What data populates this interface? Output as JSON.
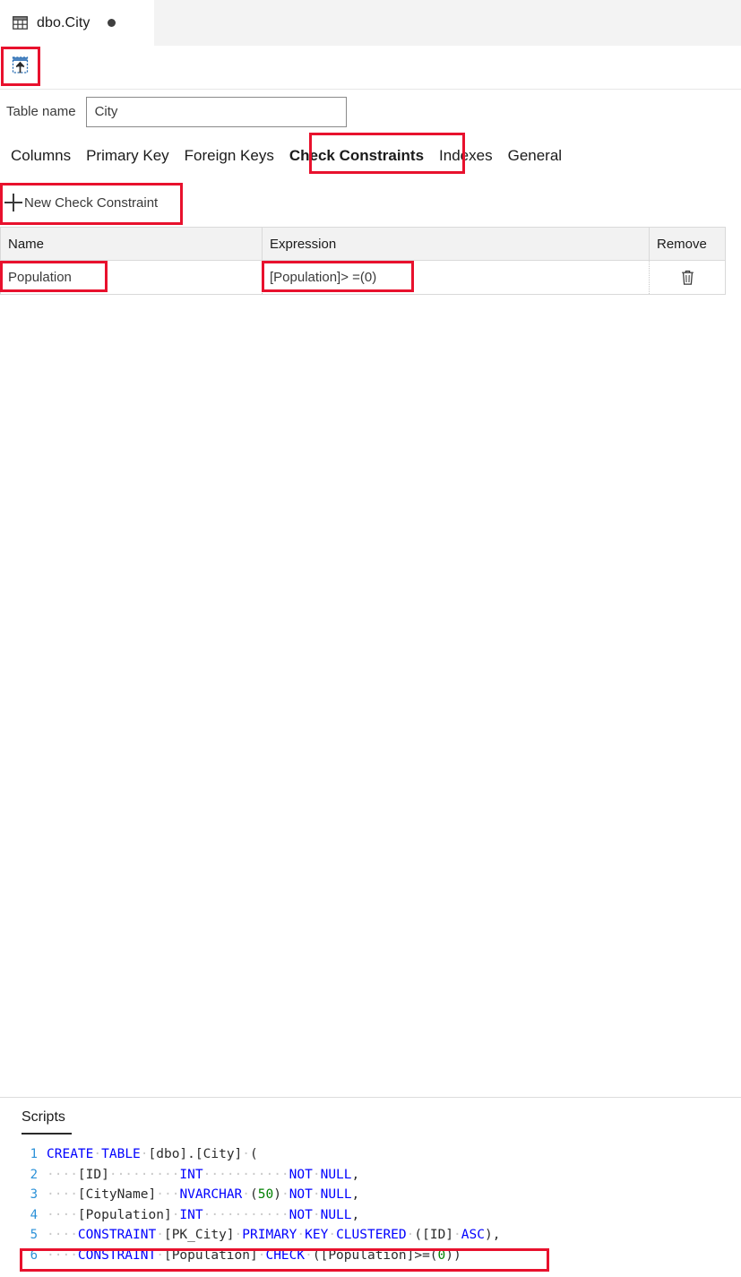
{
  "tabstrip": {
    "active_tab": {
      "title": "dbo.City",
      "icon": "table-grid-icon",
      "dirty": true
    }
  },
  "toolbar": {
    "update_button": {
      "name": "update-icon",
      "tooltip": "Update"
    }
  },
  "table_name_row": {
    "label": "Table name",
    "value": "City",
    "placeholder": ""
  },
  "designer_tabs": [
    {
      "label": "Columns",
      "active": false
    },
    {
      "label": "Primary Key",
      "active": false
    },
    {
      "label": "Foreign Keys",
      "active": false
    },
    {
      "label": "Check Constraints",
      "active": true
    },
    {
      "label": "Indexes",
      "active": false
    },
    {
      "label": "General",
      "active": false
    }
  ],
  "new_constraint_button": {
    "label": "New Check Constraint",
    "icon": "plus-icon"
  },
  "grid": {
    "columns": [
      "Name",
      "Expression",
      "Remove"
    ],
    "rows": [
      {
        "name": "Population",
        "expression": "[Population]> =(0)",
        "remove_icon": "trash-icon"
      }
    ]
  },
  "scripts": {
    "tab_label": "Scripts",
    "lines": [
      {
        "number": "1",
        "tokens": [
          {
            "t": "CREATE",
            "c": "kw"
          },
          {
            "t": "·",
            "c": "ws"
          },
          {
            "t": "TABLE",
            "c": "kw"
          },
          {
            "t": "·",
            "c": "ws"
          },
          {
            "t": "[dbo].[City]",
            "c": "id"
          },
          {
            "t": "·",
            "c": "ws"
          },
          {
            "t": "(",
            "c": "pun"
          }
        ]
      },
      {
        "number": "2",
        "tokens": [
          {
            "t": "····",
            "c": "ws"
          },
          {
            "t": "[ID]",
            "c": "id"
          },
          {
            "t": "·········",
            "c": "ws"
          },
          {
            "t": "INT",
            "c": "kw"
          },
          {
            "t": "···········",
            "c": "ws"
          },
          {
            "t": "NOT",
            "c": "kw"
          },
          {
            "t": "·",
            "c": "ws"
          },
          {
            "t": "NULL",
            "c": "kw"
          },
          {
            "t": ",",
            "c": "pun"
          }
        ]
      },
      {
        "number": "3",
        "tokens": [
          {
            "t": "····",
            "c": "ws"
          },
          {
            "t": "[CityName]",
            "c": "id"
          },
          {
            "t": "···",
            "c": "ws"
          },
          {
            "t": "NVARCHAR",
            "c": "kw"
          },
          {
            "t": "·",
            "c": "ws"
          },
          {
            "t": "(",
            "c": "pun"
          },
          {
            "t": "50",
            "c": "num"
          },
          {
            "t": ")",
            "c": "pun"
          },
          {
            "t": "·",
            "c": "ws"
          },
          {
            "t": "NOT",
            "c": "kw"
          },
          {
            "t": "·",
            "c": "ws"
          },
          {
            "t": "NULL",
            "c": "kw"
          },
          {
            "t": ",",
            "c": "pun"
          }
        ]
      },
      {
        "number": "4",
        "tokens": [
          {
            "t": "····",
            "c": "ws"
          },
          {
            "t": "[Population]",
            "c": "id"
          },
          {
            "t": "·",
            "c": "ws"
          },
          {
            "t": "INT",
            "c": "kw"
          },
          {
            "t": "···········",
            "c": "ws"
          },
          {
            "t": "NOT",
            "c": "kw"
          },
          {
            "t": "·",
            "c": "ws"
          },
          {
            "t": "NULL",
            "c": "kw"
          },
          {
            "t": ",",
            "c": "pun"
          }
        ]
      },
      {
        "number": "5",
        "tokens": [
          {
            "t": "····",
            "c": "ws"
          },
          {
            "t": "CONSTRAINT",
            "c": "kw"
          },
          {
            "t": "·",
            "c": "ws"
          },
          {
            "t": "[PK_City]",
            "c": "id"
          },
          {
            "t": "·",
            "c": "ws"
          },
          {
            "t": "PRIMARY",
            "c": "kw"
          },
          {
            "t": "·",
            "c": "ws"
          },
          {
            "t": "KEY",
            "c": "kw"
          },
          {
            "t": "·",
            "c": "ws"
          },
          {
            "t": "CLUSTERED",
            "c": "kw"
          },
          {
            "t": "·",
            "c": "ws"
          },
          {
            "t": "(",
            "c": "pun"
          },
          {
            "t": "[ID]",
            "c": "id"
          },
          {
            "t": "·",
            "c": "ws"
          },
          {
            "t": "ASC",
            "c": "kw"
          },
          {
            "t": "),",
            "c": "pun"
          }
        ]
      },
      {
        "number": "6",
        "tokens": [
          {
            "t": "····",
            "c": "ws"
          },
          {
            "t": "CONSTRAINT",
            "c": "kw"
          },
          {
            "t": "·",
            "c": "ws"
          },
          {
            "t": "[Population]",
            "c": "id"
          },
          {
            "t": "·",
            "c": "ws"
          },
          {
            "t": "CHECK",
            "c": "kw"
          },
          {
            "t": "·",
            "c": "ws"
          },
          {
            "t": "([Population]>=(",
            "c": "pun"
          },
          {
            "t": "0",
            "c": "num"
          },
          {
            "t": "))",
            "c": "pun"
          }
        ]
      }
    ]
  },
  "highlights": {
    "color": "#e8112d",
    "targets": [
      "update-toolbar-button",
      "tab-check-constraints",
      "new-check-constraint-button",
      "constraint-name-cell",
      "constraint-expression-cell",
      "script-line-6"
    ]
  }
}
